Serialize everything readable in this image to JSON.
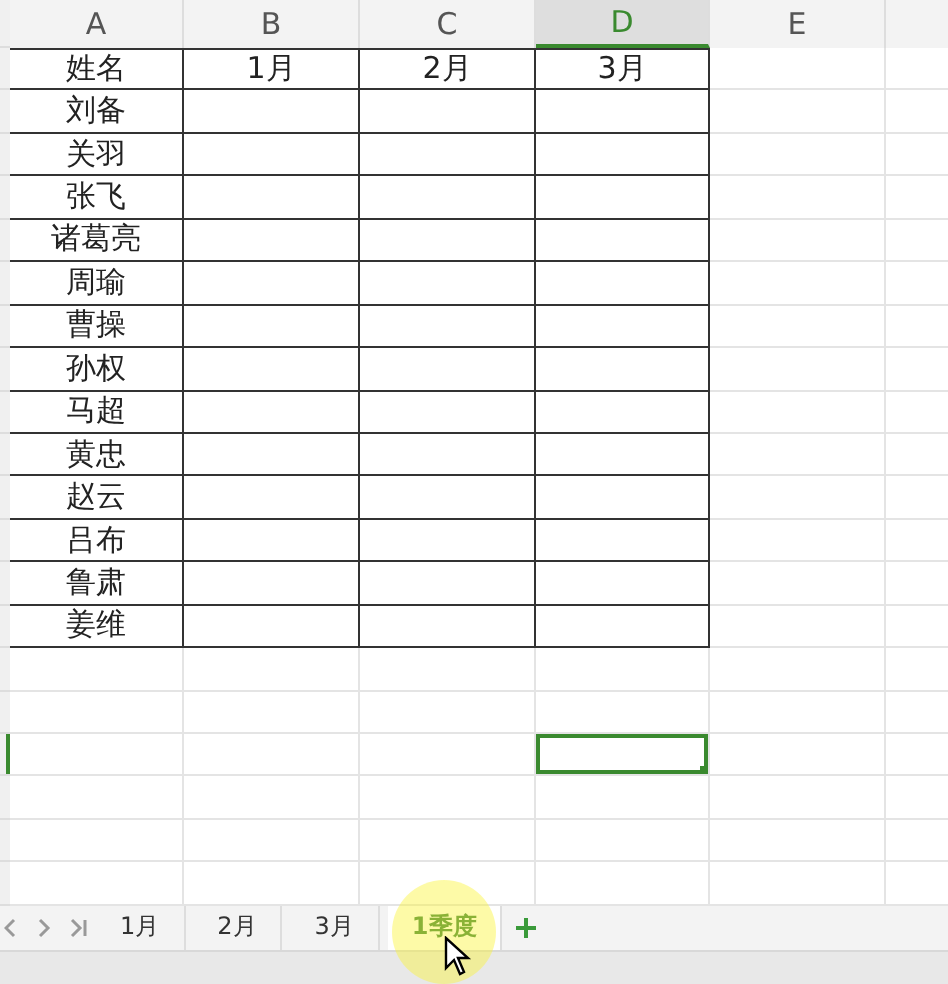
{
  "columns": [
    {
      "label": "A",
      "selected": false
    },
    {
      "label": "B",
      "selected": false
    },
    {
      "label": "C",
      "selected": false
    },
    {
      "label": "D",
      "selected": true
    },
    {
      "label": "E",
      "selected": false
    }
  ],
  "table": {
    "header": [
      "姓名",
      "1月",
      "2月",
      "3月"
    ],
    "names": [
      "刘备",
      "关羽",
      "张飞",
      "诸葛亮",
      "周瑜",
      "曹操",
      "孙权",
      "马超",
      "黄忠",
      "赵云",
      "吕布",
      "鲁肃",
      "姜维"
    ]
  },
  "empty_rows": [
    {
      "selected": false
    },
    {
      "selected": false
    },
    {
      "selected": true
    },
    {
      "selected": false
    },
    {
      "selected": false
    },
    {
      "selected": false
    }
  ],
  "sheet_tabs": [
    {
      "label": "1月",
      "selected": false
    },
    {
      "label": "2月",
      "selected": false
    },
    {
      "label": "3月",
      "selected": false
    },
    {
      "label": "1季度",
      "selected": true
    }
  ]
}
